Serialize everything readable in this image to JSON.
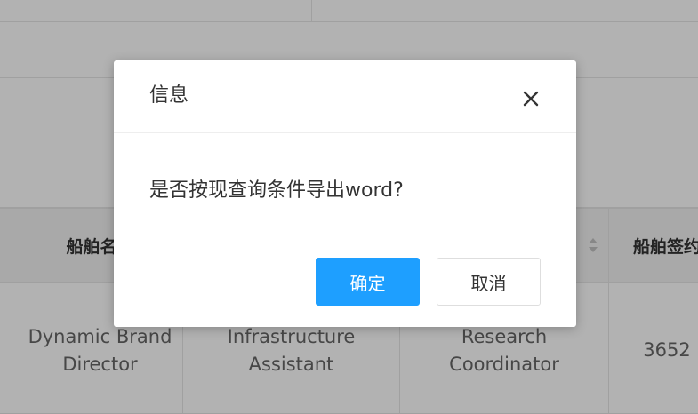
{
  "table": {
    "headers": [
      "船舶名称",
      "",
      "",
      "船舶签约"
    ],
    "row": {
      "col1": [
        "Dynamic Brand",
        "Director"
      ],
      "col2": [
        "Infrastructure",
        "Assistant"
      ],
      "col3": [
        "Research",
        "Coordinator"
      ],
      "col4": "3652"
    }
  },
  "dialog": {
    "title": "信息",
    "message": "是否按现查询条件导出word?",
    "confirm_label": "确定",
    "cancel_label": "取消",
    "close_icon": "close-icon"
  },
  "colors": {
    "primary": "#1e9fff",
    "overlay": "rgba(0,0,0,0.3)",
    "header_bg": "#f2f2f2"
  }
}
